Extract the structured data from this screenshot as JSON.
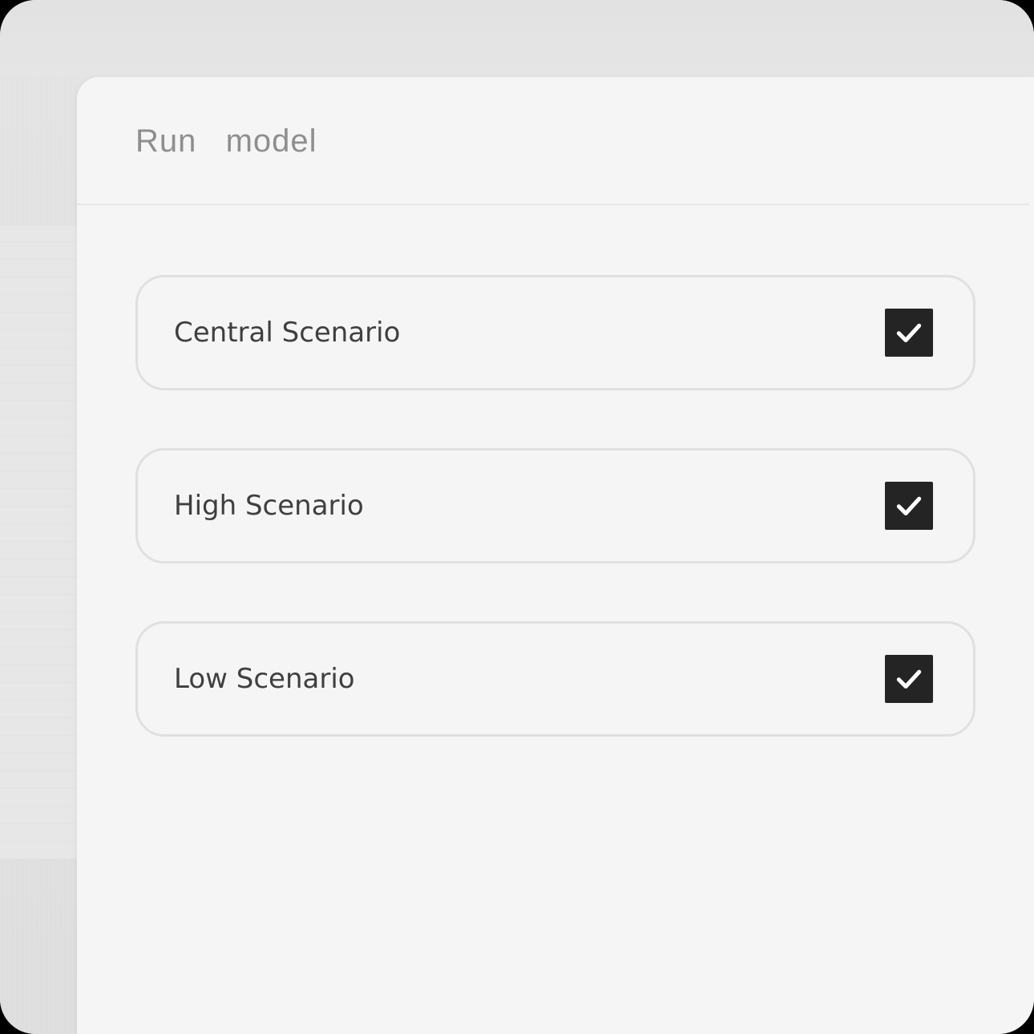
{
  "panel": {
    "title": "Run  model"
  },
  "options": [
    {
      "label": "Central Scenario",
      "checked": true
    },
    {
      "label": "High Scenario",
      "checked": true
    },
    {
      "label": "Low Scenario",
      "checked": true
    }
  ],
  "colors": {
    "panel_background": "#f5f5f5",
    "backdrop": "#e4e4e4",
    "checkbox_fill": "#242424",
    "checkmark": "#ffffff",
    "card_border": "#e0e0e0",
    "title_text": "#8e8e8e",
    "label_text": "#3f3f3f"
  },
  "icons": {
    "checkbox_icon": "checkmark-icon"
  }
}
